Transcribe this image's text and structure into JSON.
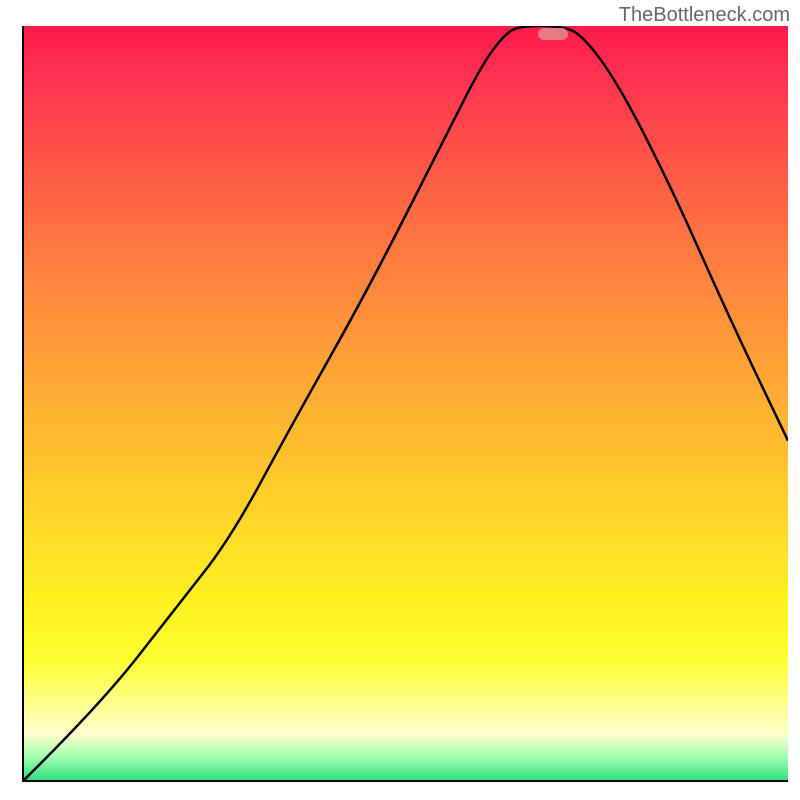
{
  "watermark": "TheBottleneck.com",
  "chart_data": {
    "type": "line",
    "title": "",
    "xlabel": "",
    "ylabel": "",
    "x_range_pct": [
      0,
      100
    ],
    "y_range_pct": [
      0,
      100
    ],
    "curve_points_pct": [
      [
        0,
        0
      ],
      [
        10,
        10
      ],
      [
        20,
        23
      ],
      [
        27,
        32
      ],
      [
        35,
        47
      ],
      [
        45,
        65
      ],
      [
        55,
        85
      ],
      [
        60,
        95
      ],
      [
        63,
        99
      ],
      [
        65,
        100
      ],
      [
        70,
        100
      ],
      [
        73,
        99
      ],
      [
        78,
        92
      ],
      [
        85,
        78
      ],
      [
        92,
        62
      ],
      [
        100,
        45
      ]
    ],
    "marker_position_pct": [
      69,
      99
    ],
    "gradient_stops": [
      {
        "pct": 0,
        "color": "#ff1a4a"
      },
      {
        "pct": 50,
        "color": "#ffba30"
      },
      {
        "pct": 85,
        "color": "#ffff30"
      },
      {
        "pct": 100,
        "color": "#30e080"
      }
    ]
  }
}
